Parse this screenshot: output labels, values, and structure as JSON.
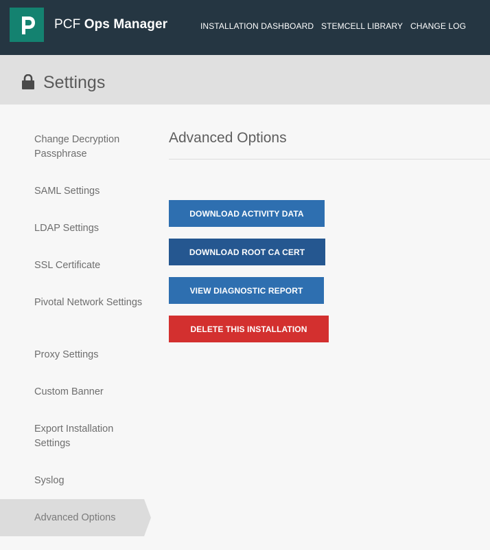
{
  "header": {
    "brand_prefix": "PCF",
    "brand_name": "Ops Manager",
    "logo_letter": "P",
    "nav": [
      {
        "label": "INSTALLATION DASHBOARD"
      },
      {
        "label": "STEMCELL LIBRARY"
      },
      {
        "label": "CHANGE LOG"
      }
    ]
  },
  "page": {
    "title": "Settings",
    "icon": "lock-icon"
  },
  "sidebar": {
    "items": [
      {
        "label": "Change Decryption Passphrase"
      },
      {
        "label": "SAML Settings"
      },
      {
        "label": "LDAP Settings"
      },
      {
        "label": "SSL Certificate"
      },
      {
        "label": "Pivotal Network Settings"
      },
      {
        "label": "Proxy Settings"
      },
      {
        "label": "Custom Banner"
      },
      {
        "label": "Export Installation Settings"
      },
      {
        "label": "Syslog"
      },
      {
        "label": "Advanced Options",
        "active": true
      }
    ]
  },
  "main": {
    "section_title": "Advanced Options",
    "buttons": [
      {
        "label": "DOWNLOAD ACTIVITY DATA"
      },
      {
        "label": "DOWNLOAD ROOT CA CERT"
      },
      {
        "label": "VIEW DIAGNOSTIC REPORT"
      },
      {
        "label": "DELETE THIS INSTALLATION"
      }
    ]
  },
  "colors": {
    "header_bg": "#253642",
    "logo_bg": "#148270",
    "titlebar_bg": "#e0e0e0",
    "primary_button": "#2e6fb0",
    "primary_button_dark": "#255790",
    "danger_button": "#d3302f",
    "active_sidebar_bg": "#dcdcdc"
  }
}
